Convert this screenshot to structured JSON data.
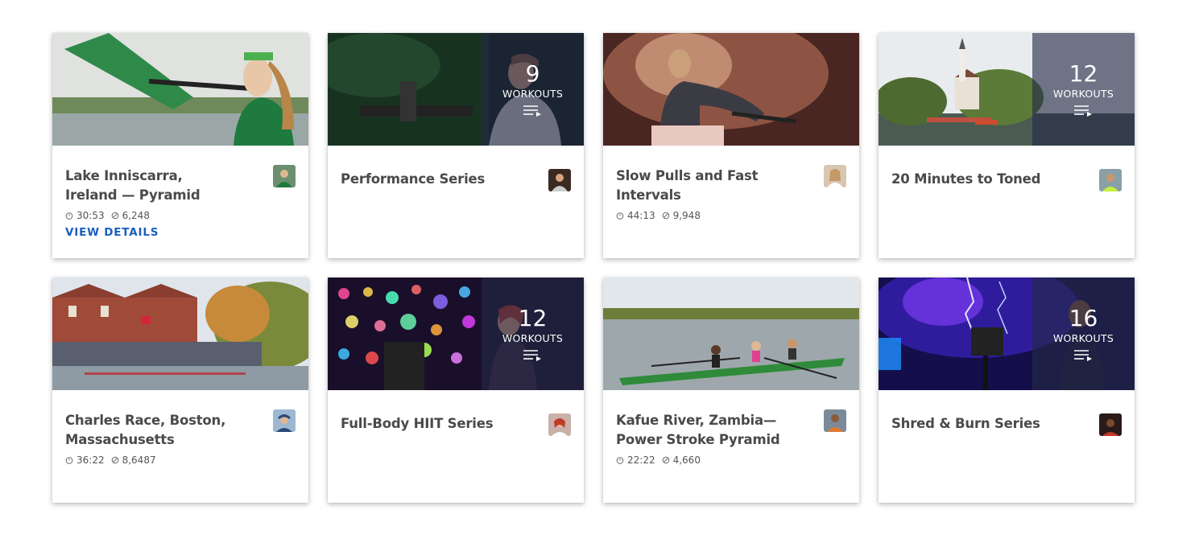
{
  "cards": [
    {
      "title": "Lake Inniscarra, Ireland — Pyramid",
      "duration": "30:53",
      "meters": "6,248",
      "cta": "VIEW DETAILS"
    },
    {
      "title": "Performance Series",
      "count": "9",
      "count_label": "WORKOUTS"
    },
    {
      "title": "Slow Pulls and Fast Intervals",
      "duration": "44:13",
      "meters": "9,948"
    },
    {
      "title": "20 Minutes to Toned",
      "count": "12",
      "count_label": "WORKOUTS"
    },
    {
      "title": "Charles Race, Boston, Massachusetts",
      "duration": "36:22",
      "meters": "8,6487"
    },
    {
      "title": "Full-Body HIIT Series",
      "count": "12",
      "count_label": "WORKOUTS"
    },
    {
      "title": "Kafue River, Zambia— Power Stroke Pyramid",
      "duration": "22:22",
      "meters": "4,660"
    },
    {
      "title": "Shred & Burn Series",
      "count": "16",
      "count_label": "WORKOUTS"
    }
  ],
  "colors": {
    "link": "#1a5fc1",
    "overlay": "#232a46",
    "title": "#4a4a4a"
  },
  "icons": {
    "duration": "stopwatch-icon",
    "meters": "distance-icon",
    "series": "playlist-icon"
  }
}
